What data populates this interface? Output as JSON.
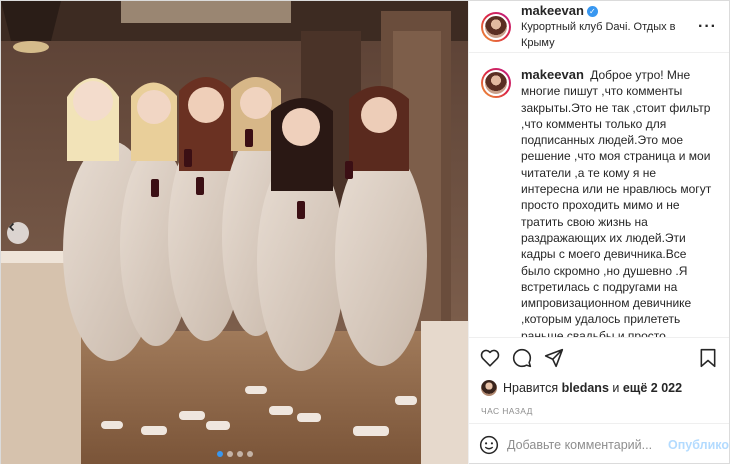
{
  "post": {
    "author": {
      "username": "makeevan",
      "verified": true,
      "location": "Курортный клуб Dачі. Отдых в Крыму"
    },
    "caption": {
      "username": "makeevan",
      "text": "Доброе утро! Мне многие пишут ,что комменты закрыты.Это не так ,стоит фильтр ,что комменты только для подписанных людей.Это мое решение ,что моя страница и мои читатели ,а те кому я не интересна или не нравлюсь могут просто проходить мимо и не тратить свою жизнь на раздражающих их людей.Эти кадры с моего девичника.Все было скромно ,но душевно .Я встретилась с подругами на импровизационном девичнике ,которым удалось прилететь раньше свадьбы и просто пообщаться.Моя свадьба и девичник прошли в воздержании во всем.Перед венчанием я держала пост и поэтому"
    },
    "likes": {
      "prefix": "Нравится",
      "user": "bledans",
      "middle": "и",
      "count_text": "ещё 2 022"
    },
    "time": "час назад",
    "comment": {
      "placeholder": "Добавьте комментарий...",
      "publish_label": "Опубликовать"
    },
    "carousel": {
      "dot_count": 4,
      "active_index": 0
    },
    "colors": {
      "accent": "#3897f0",
      "publish_disabled": "#b3dbff",
      "muted": "#8e8e8e"
    },
    "icons": {
      "more": "more-options-icon",
      "like": "heart-icon",
      "comment": "comment-icon",
      "share": "share-icon",
      "save": "bookmark-icon",
      "emoji": "emoji-icon",
      "prev": "chevron-left-icon"
    }
  }
}
